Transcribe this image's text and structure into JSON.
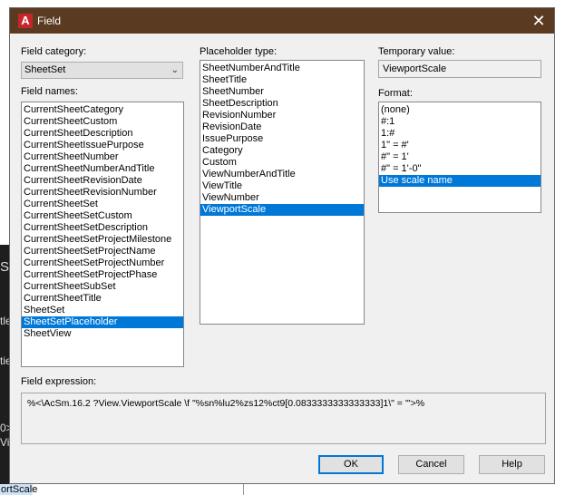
{
  "dialog": {
    "title": "Field",
    "close_glyph": "✕"
  },
  "field_category": {
    "label": "Field category:",
    "value": "SheetSet"
  },
  "field_names": {
    "label": "Field names:",
    "items": [
      {
        "label": "CurrentSheetCategory",
        "selected": false
      },
      {
        "label": "CurrentSheetCustom",
        "selected": false
      },
      {
        "label": "CurrentSheetDescription",
        "selected": false
      },
      {
        "label": "CurrentSheetIssuePurpose",
        "selected": false
      },
      {
        "label": "CurrentSheetNumber",
        "selected": false
      },
      {
        "label": "CurrentSheetNumberAndTitle",
        "selected": false
      },
      {
        "label": "CurrentSheetRevisionDate",
        "selected": false
      },
      {
        "label": "CurrentSheetRevisionNumber",
        "selected": false
      },
      {
        "label": "CurrentSheetSet",
        "selected": false
      },
      {
        "label": "CurrentSheetSetCustom",
        "selected": false
      },
      {
        "label": "CurrentSheetSetDescription",
        "selected": false
      },
      {
        "label": "CurrentSheetSetProjectMilestone",
        "selected": false
      },
      {
        "label": "CurrentSheetSetProjectName",
        "selected": false
      },
      {
        "label": "CurrentSheetSetProjectNumber",
        "selected": false
      },
      {
        "label": "CurrentSheetSetProjectPhase",
        "selected": false
      },
      {
        "label": "CurrentSheetSubSet",
        "selected": false
      },
      {
        "label": "CurrentSheetTitle",
        "selected": false
      },
      {
        "label": "SheetSet",
        "selected": false
      },
      {
        "label": "SheetSetPlaceholder",
        "selected": true
      },
      {
        "label": "SheetView",
        "selected": false
      }
    ]
  },
  "placeholder_type": {
    "label": "Placeholder type:",
    "items": [
      {
        "label": "SheetNumberAndTitle",
        "selected": false
      },
      {
        "label": "SheetTitle",
        "selected": false
      },
      {
        "label": "SheetNumber",
        "selected": false
      },
      {
        "label": "SheetDescription",
        "selected": false
      },
      {
        "label": "RevisionNumber",
        "selected": false
      },
      {
        "label": "RevisionDate",
        "selected": false
      },
      {
        "label": "IssuePurpose",
        "selected": false
      },
      {
        "label": "Category",
        "selected": false
      },
      {
        "label": "Custom",
        "selected": false
      },
      {
        "label": "ViewNumberAndTitle",
        "selected": false
      },
      {
        "label": "ViewTitle",
        "selected": false
      },
      {
        "label": "ViewNumber",
        "selected": false
      },
      {
        "label": "ViewportScale",
        "selected": true
      }
    ]
  },
  "temporary_value": {
    "label": "Temporary value:",
    "value": "ViewportScale"
  },
  "format": {
    "label": "Format:",
    "items": [
      {
        "label": "(none)",
        "selected": false
      },
      {
        "label": "#:1",
        "selected": false
      },
      {
        "label": "1:#",
        "selected": false
      },
      {
        "label": "1\" = #'",
        "selected": false
      },
      {
        "label": "#\" = 1'",
        "selected": false
      },
      {
        "label": "#\" = 1'-0\"",
        "selected": false
      },
      {
        "label": "Use scale name",
        "selected": true
      }
    ]
  },
  "field_expression": {
    "label": "Field expression:",
    "value": "%<\\AcSm.16.2 ?View.ViewportScale \\f \"%sn%lu2%zs12%ct9[0.0833333333333333]1\\\" = '\">%"
  },
  "buttons": {
    "ok": "OK",
    "cancel": "Cancel",
    "help": "Help"
  },
  "background": {
    "frag_s": "S",
    "frag_tle": "tle",
    "frag_tie": "tie",
    "frag_0": "0>",
    "frag_vie": "Vie",
    "bottom_text": "ortScale"
  },
  "icons": {
    "app": "autocad-logo-icon",
    "dropdown": "chevron-down-icon",
    "close": "close-icon"
  },
  "colors": {
    "titlebar": "#5a3a21",
    "selection": "#0078d7",
    "logo": "#c6252b"
  }
}
